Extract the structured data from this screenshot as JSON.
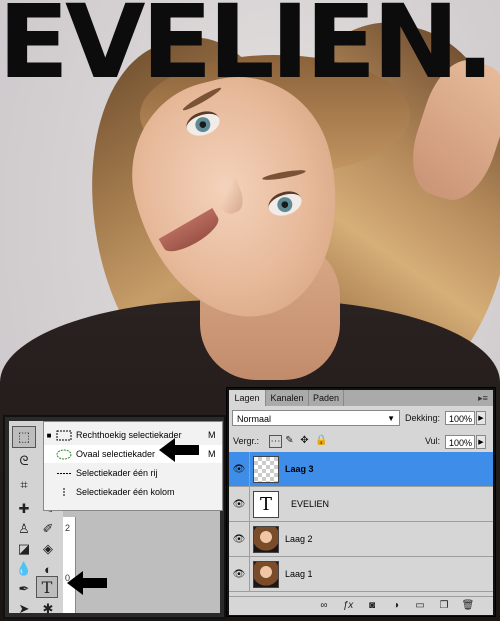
{
  "photo": {
    "title": "EVELIEN."
  },
  "tools_flyout": {
    "items": [
      {
        "label": "Rechthoekig selectiekader",
        "shortcut": "M",
        "selected": true
      },
      {
        "label": "Ovaal selectiekader",
        "shortcut": "M",
        "selected": false
      },
      {
        "label": "Selectiekader één rij",
        "shortcut": "",
        "selected": false
      },
      {
        "label": "Selectiekader één kolom",
        "shortcut": "",
        "selected": false
      }
    ]
  },
  "ruler": {
    "marks": [
      "2",
      "0"
    ]
  },
  "layers_panel": {
    "tabs": [
      "Lagen",
      "Kanalen",
      "Paden"
    ],
    "active_tab": "Lagen",
    "blend_mode": "Normaal",
    "opacity_label": "Dekking:",
    "opacity_value": "100%",
    "lock_label": "Vergr.:",
    "fill_label": "Vul:",
    "fill_value": "100%",
    "layers": [
      {
        "name": "Laag 3",
        "selected": true,
        "thumb": "checker"
      },
      {
        "name": "EVELIEN",
        "selected": false,
        "thumb": "text"
      },
      {
        "name": "Laag 2",
        "selected": false,
        "thumb": "photo"
      },
      {
        "name": "Laag 1",
        "selected": false,
        "thumb": "photo"
      }
    ],
    "selection_color": "#3e8de8"
  }
}
